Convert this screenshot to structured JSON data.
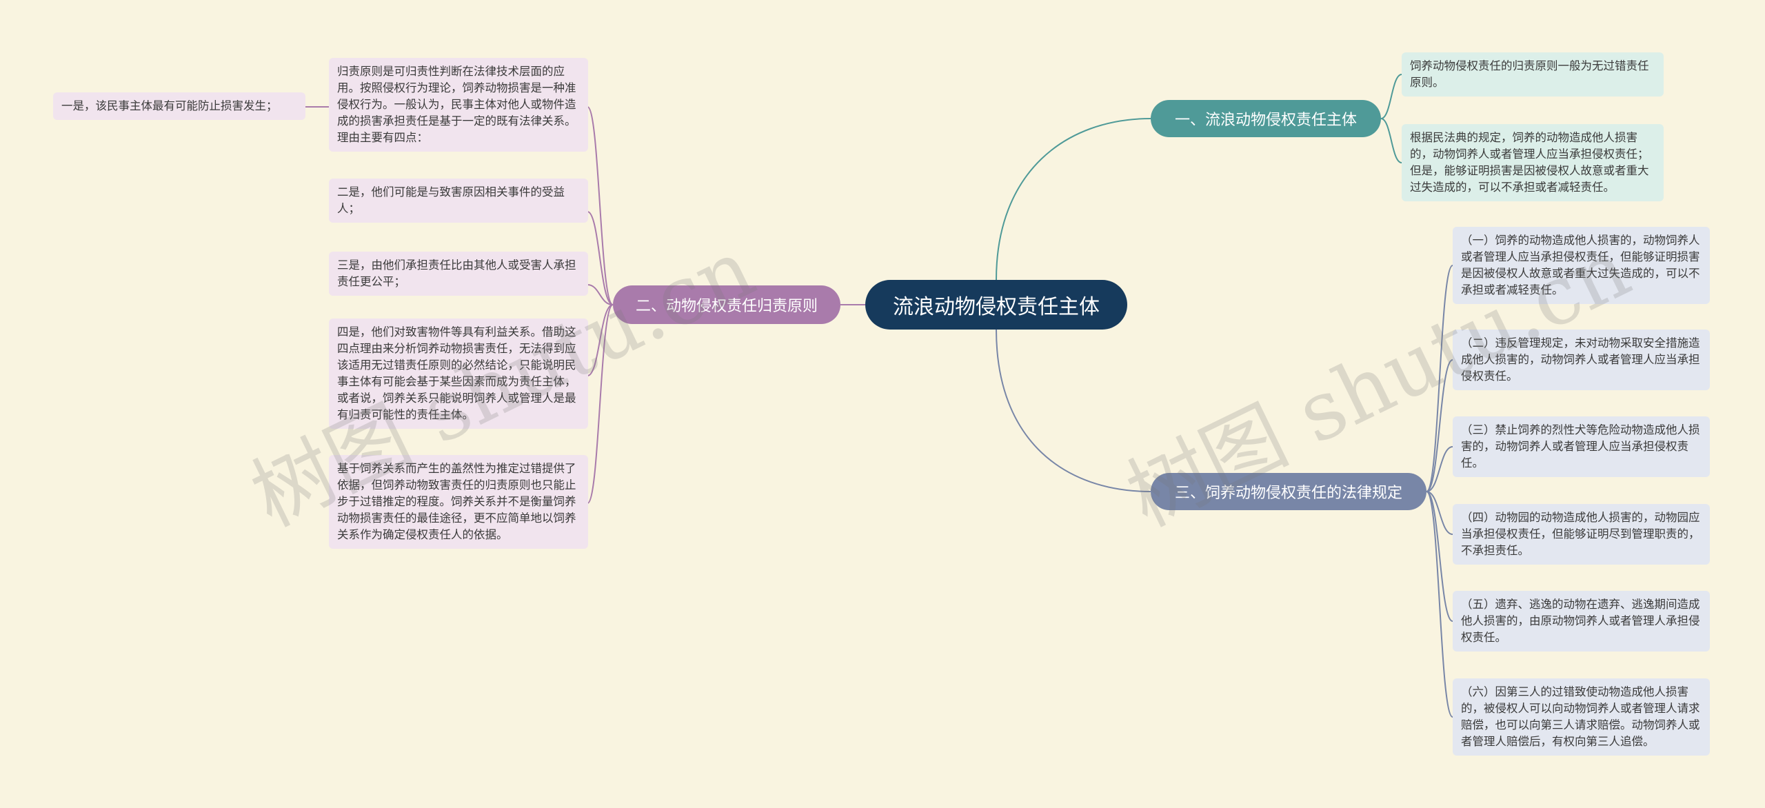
{
  "root": {
    "label": "流浪动物侵权责任主体"
  },
  "branches": {
    "b1": {
      "label": "一、流浪动物侵权责任主体",
      "leaves": [
        "饲养动物侵权责任的归责原则一般为无过错责任原则。",
        "根据民法典的规定，饲养的动物造成他人损害的，动物饲养人或者管理人应当承担侵权责任；但是，能够证明损害是因被侵权人故意或者重大过失造成的，可以不承担或者减轻责任。"
      ]
    },
    "b2": {
      "label": "二、动物侵权责任归责原则",
      "leaves": [
        "归责原则是可归责性判断在法律技术层面的应用。按照侵权行为理论，饲养动物损害是一种准侵权行为。一般认为，民事主体对他人或物件造成的损害承担责任是基于一定的既有法律关系。理由主要有四点：",
        "二是，他们可能是与致害原因相关事件的受益人；",
        "三是，由他们承担责任比由其他人或受害人承担责任更公平；",
        "四是，他们对致害物件等具有利益关系。借助这四点理由来分析饲养动物损害责任，无法得到应该适用无过错责任原则的必然结论，只能说明民事主体有可能会基于某些因素而成为责任主体，或者说，饲养关系只能说明饲养人或管理人是最有归责可能性的责任主体。",
        "基于饲养关系而产生的盖然性为推定过错提供了依据，但饲养动物致害责任的归责原则也只能止步于过错推定的程度。饲养关系并不是衡量饲养动物损害责任的最佳途径，更不应简单地以饲养关系作为确定侵权责任人的依据。"
      ],
      "subleaf": "一是，该民事主体最有可能防止损害发生；"
    },
    "b3": {
      "label": "三、饲养动物侵权责任的法律规定",
      "leaves": [
        "（一）饲养的动物造成他人损害的，动物饲养人或者管理人应当承担侵权责任，但能够证明损害是因被侵权人故意或者重大过失造成的，可以不承担或者减轻责任。",
        "（二）违反管理规定，未对动物采取安全措施造成他人损害的，动物饲养人或者管理人应当承担侵权责任。",
        "（三）禁止饲养的烈性犬等危险动物造成他人损害的，动物饲养人或者管理人应当承担侵权责任。",
        "（四）动物园的动物造成他人损害的，动物园应当承担侵权责任，但能够证明尽到管理职责的，不承担责任。",
        "（五）遗弃、逃逸的动物在遗弃、逃逸期间造成他人损害的，由原动物饲养人或者管理人承担侵权责任。",
        "（六）因第三人的过错致使动物造成他人损害的，被侵权人可以向动物饲养人或者管理人请求赔偿，也可以向第三人请求赔偿。动物饲养人或者管理人赔偿后，有权向第三人追偿。"
      ]
    }
  },
  "watermarks": [
    "树图 shutu.cn",
    "树图 shutu.cn"
  ],
  "colors": {
    "background": "#f9f4e0",
    "root": "#163a5c",
    "branch1": "#4f9a98",
    "branch2": "#a97bab",
    "branch3": "#7886a7"
  }
}
